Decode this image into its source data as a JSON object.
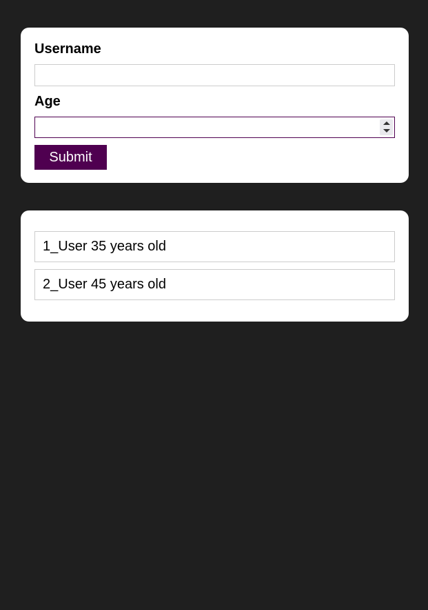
{
  "form": {
    "username_label": "Username",
    "username_value": "",
    "age_label": "Age",
    "age_value": "",
    "submit_label": "Submit"
  },
  "users": [
    {
      "label": "1_User 35 years old"
    },
    {
      "label": "2_User 45 years old"
    }
  ],
  "colors": {
    "background": "#1f1f1f",
    "card": "#ffffff",
    "accent": "#4f0050"
  }
}
